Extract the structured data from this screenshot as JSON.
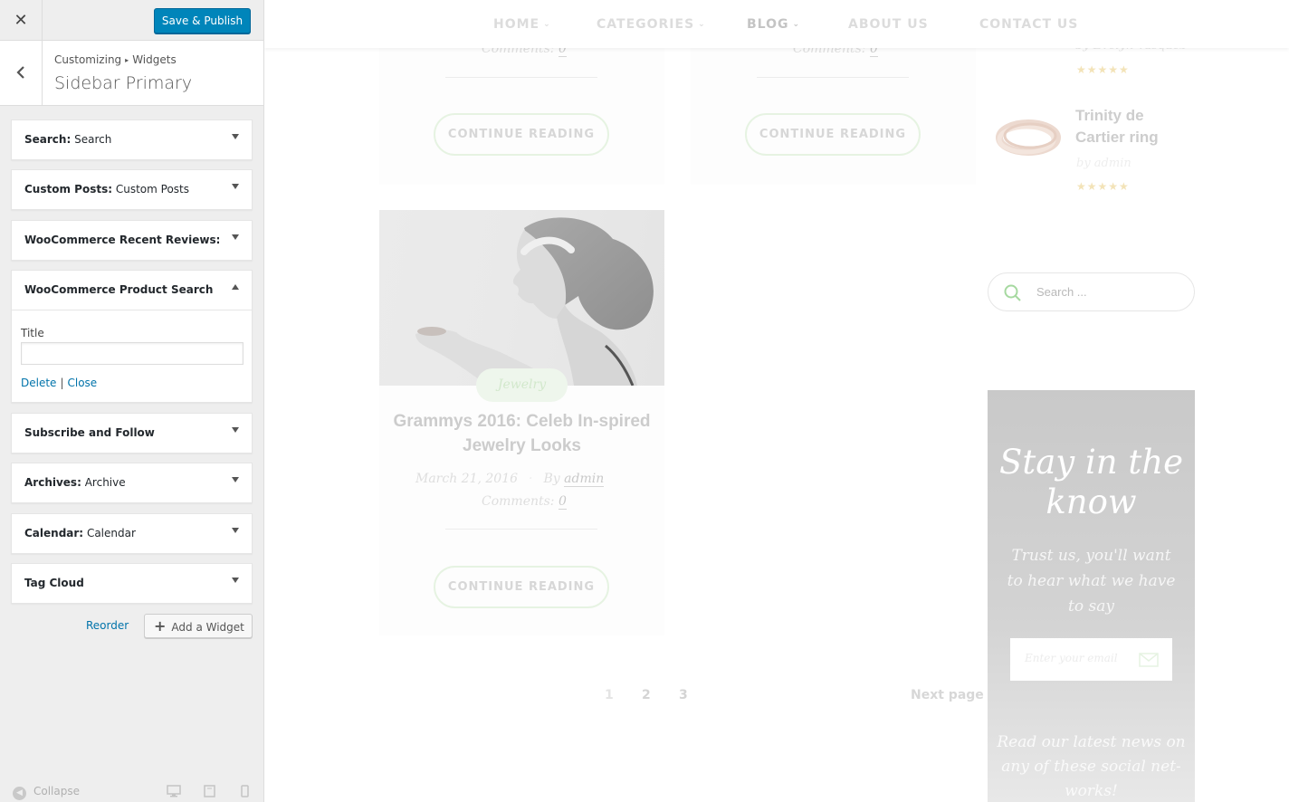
{
  "customizer": {
    "close_icon": "close-icon",
    "publish_label": "Save & Publish",
    "back_icon": "chevron-left-icon",
    "breadcrumb_root": "Customizing",
    "breadcrumb_child": "Widgets",
    "section_title": "Sidebar Primary",
    "widgets": [
      {
        "type": "Search:",
        "name": "Search"
      },
      {
        "type": "Custom Posts:",
        "name": "Custom Posts"
      },
      {
        "type": "WooCommerce Recent Reviews: ...",
        "name": ""
      },
      {
        "type": "WooCommerce Product Search",
        "name": "",
        "expanded": true
      },
      {
        "type": "Subscribe and Follow",
        "name": ""
      },
      {
        "type": "Archives:",
        "name": "Archive"
      },
      {
        "type": "Calendar:",
        "name": "Calendar"
      },
      {
        "type": "Tag Cloud",
        "name": ""
      }
    ],
    "expanded_widget": {
      "field_label": "Title",
      "title_value": "",
      "delete_label": "Delete",
      "separator": "|",
      "close_label": "Close"
    },
    "reorder_label": "Reorder",
    "add_widget_label": "Add a Widget",
    "collapse_label": "Collapse",
    "devices": [
      "desktop-icon",
      "tablet-icon",
      "mobile-icon"
    ]
  },
  "preview": {
    "nav": [
      "HOME",
      "CATEGORIES",
      "BLOG",
      "ABOUT US",
      "CONTACT US"
    ],
    "top_cards": [
      {
        "comments_label": "Comments:",
        "comments": "0",
        "button": "CONTINUE READING"
      },
      {
        "comments_label": "Comments:",
        "comments": "0",
        "button": "CONTINUE READING"
      }
    ],
    "post": {
      "tag": "Jewelry",
      "title": "Grammys 2016: Celeb In-spired Jewelry Looks",
      "date": "March 21, 2016",
      "by_label": "By",
      "author": "admin",
      "comments_label": "Comments:",
      "comments": "0",
      "button": "CONTINUE READING"
    },
    "pagination": [
      "1",
      "2",
      "3"
    ],
    "next_page": "Next page",
    "sidebar": {
      "review_top_author": "by Evelyn Vasquez",
      "stars": "★★★★★",
      "product_name": "Trinity de Cartier ring",
      "product_author": "by admin",
      "search_placeholder": "Search ...",
      "subscribe_title": "Stay in the know",
      "subscribe_sub": "Trust us, you'll want to hear what we have to say",
      "email_placeholder": "Enter your email",
      "social_text": "Read our latest news on any of these social net-works!"
    }
  },
  "colors": {
    "publish_button": "#0085ba",
    "link": "#0073aa",
    "panel_bg": "#eeeeee"
  }
}
